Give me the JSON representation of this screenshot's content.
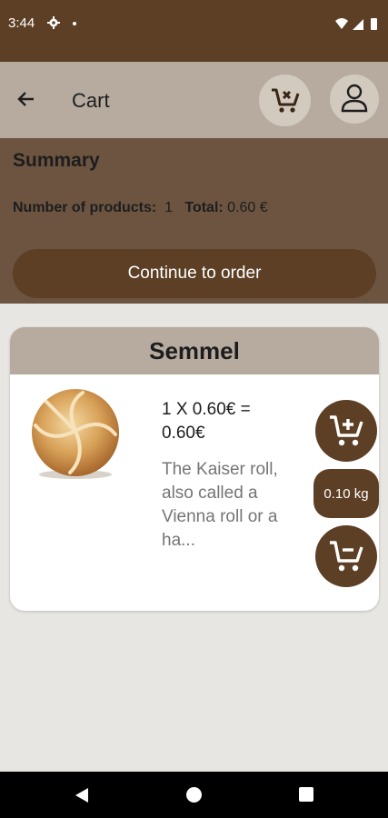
{
  "status_bar": {
    "time": "3:44",
    "icons": [
      "gear-icon",
      "notification-dot",
      "wifi-icon",
      "signal-icon",
      "battery-icon"
    ]
  },
  "toolbar": {
    "title": "Cart",
    "back_icon": "arrow-back-icon",
    "clear_cart_icon": "cart-remove-icon",
    "account_icon": "person-icon"
  },
  "summary": {
    "title": "Summary",
    "products_label": "Number of products:",
    "products_value": "1",
    "total_label": "Total:",
    "total_value": "0.60 €",
    "continue_label": "Continue to order"
  },
  "cart_items": [
    {
      "name": "Semmel",
      "price_line": "1 X 0.60€ = 0.60€",
      "description": "The Kaiser roll, also called a Vienna roll or a ha...",
      "quantity": "0.10 kg",
      "add_icon": "cart-plus-icon",
      "remove_icon": "cart-minus-icon"
    }
  ],
  "colors": {
    "primary": "#5c3f25",
    "surface": "#b7aba0",
    "summary_bg": "#6c5440",
    "background": "#e8e6e3"
  }
}
